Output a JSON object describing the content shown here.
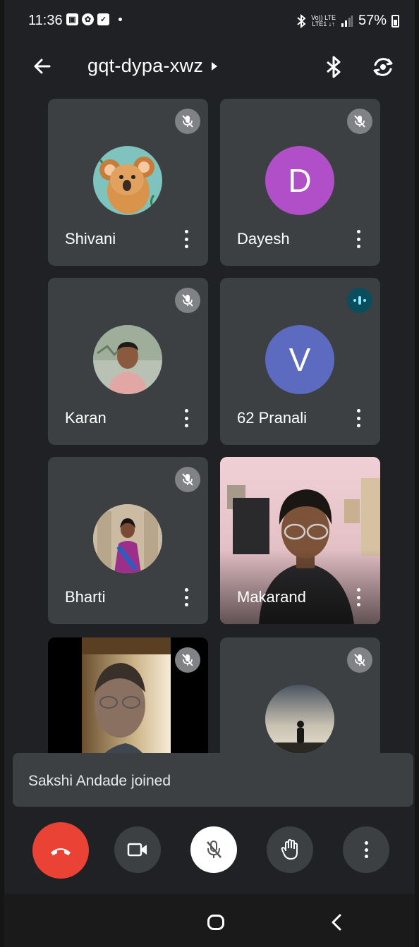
{
  "status_bar": {
    "time": "11:36",
    "network_top": "Vo)) LTE",
    "network_bottom": "LTE1 ↓↑",
    "battery": "57%"
  },
  "header": {
    "meeting_code": "gqt-dypa-xwz",
    "icons": [
      "back-arrow-icon",
      "bluetooth-icon",
      "switch-camera-icon"
    ]
  },
  "participants": [
    {
      "name": "Shivani",
      "avatar_type": "photo",
      "muted": true
    },
    {
      "name": "Dayesh",
      "avatar_type": "letter",
      "letter": "D",
      "avatar_color": "#b04fc7",
      "muted": true
    },
    {
      "name": "Karan",
      "avatar_type": "photo",
      "muted": true
    },
    {
      "name": "62 Pranali",
      "avatar_type": "letter",
      "letter": "V",
      "avatar_color": "#5c6bc0",
      "muted": false,
      "speaking": true
    },
    {
      "name": "Bharti",
      "avatar_type": "photo",
      "muted": true
    },
    {
      "name": "Makarand",
      "avatar_type": "video",
      "muted": false
    },
    {
      "name": "",
      "avatar_type": "video",
      "muted": true
    },
    {
      "name": "",
      "avatar_type": "photo",
      "muted": true
    }
  ],
  "toast": {
    "text": "Sakshi Andade joined"
  },
  "controls": {
    "buttons": [
      "end-call-icon",
      "camera-icon",
      "mic-off-icon",
      "raise-hand-icon",
      "more-options-icon"
    ],
    "end_color": "#ea4335"
  },
  "colors": {
    "background": "#202124",
    "tile": "#3c4043",
    "muted_badge": "#808286",
    "speaking_badge": "#0a4e5e"
  }
}
